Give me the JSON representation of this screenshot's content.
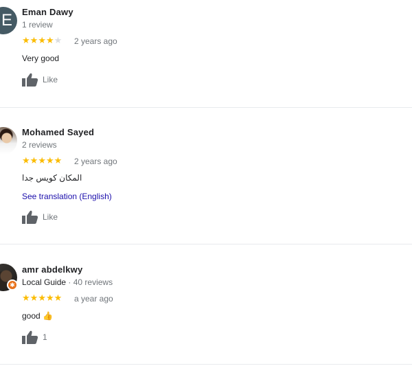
{
  "reviews": [
    {
      "avatar_letter": "E",
      "name": "Eman Dawy",
      "meta": "1 review",
      "stars": 4,
      "date": "2 years ago",
      "text": "Very good",
      "like_label": "Like"
    },
    {
      "name": "Mohamed Sayed",
      "meta": "2 reviews",
      "stars": 5,
      "date": "2 years ago",
      "text": "المكان كويس جدا",
      "translate_link": "See translation (English)",
      "like_label": "Like"
    },
    {
      "name": "amr abdelkwy",
      "guide_label": "Local Guide",
      "meta": " · 40 reviews",
      "stars": 5,
      "date": "a year ago",
      "text": "good",
      "emoji": "👍",
      "like_label": "1"
    }
  ],
  "colors": {
    "star": "#fbbc04",
    "star_empty": "#dadce0",
    "link": "#1a0dab",
    "muted": "#70757a",
    "guide_badge": "#e8711a"
  }
}
